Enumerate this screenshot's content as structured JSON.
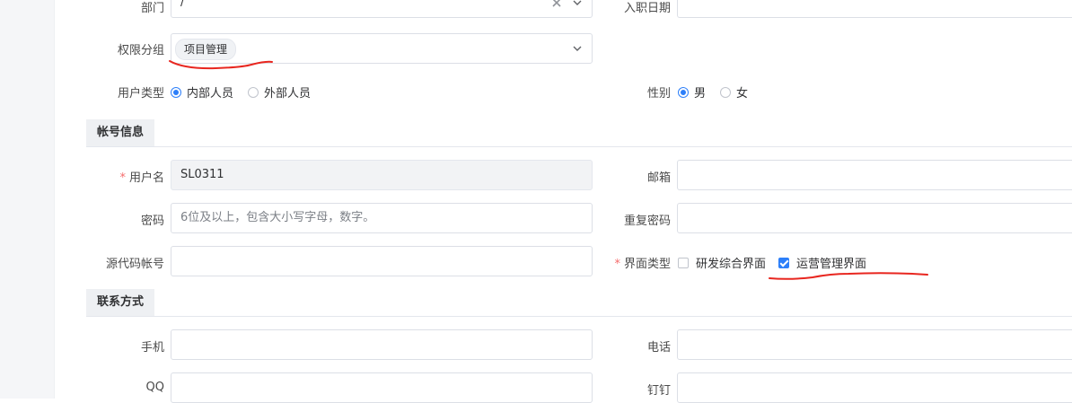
{
  "form": {
    "department": {
      "label": "部门",
      "value": "/"
    },
    "hire_date": {
      "label": "入职日期",
      "value": ""
    },
    "permission_group": {
      "label": "权限分组",
      "tags": [
        "项目管理"
      ]
    },
    "user_type": {
      "label": "用户类型",
      "options": [
        "内部人员",
        "外部人员"
      ],
      "selected": "内部人员"
    },
    "gender": {
      "label": "性别",
      "options": [
        "男",
        "女"
      ],
      "selected": "男"
    }
  },
  "sections": {
    "account": "帐号信息",
    "contact": "联系方式"
  },
  "account": {
    "username": {
      "label": "用户名",
      "value": "SL0311",
      "required": true,
      "disabled": true
    },
    "email": {
      "label": "邮箱",
      "value": ""
    },
    "password": {
      "label": "密码",
      "placeholder": "6位及以上，包含大小写字母，数字。"
    },
    "repeat_password": {
      "label": "重复密码",
      "value": ""
    },
    "source_code_account": {
      "label": "源代码帐号",
      "value": ""
    },
    "interface_type": {
      "label": "界面类型",
      "required": true,
      "options": [
        {
          "label": "研发综合界面",
          "checked": false
        },
        {
          "label": "运营管理界面",
          "checked": true
        }
      ]
    }
  },
  "contact": {
    "mobile": {
      "label": "手机",
      "value": ""
    },
    "phone": {
      "label": "电话",
      "value": ""
    },
    "qq": {
      "label": "QQ",
      "value": ""
    },
    "dingtalk": {
      "label": "钉钉",
      "value": ""
    }
  },
  "colors": {
    "accent": "#2d7ff9",
    "required": "#f56c6c",
    "annotation": "#e8261f"
  },
  "icons": {
    "select_arrow": "chevron-down-icon",
    "clear": "close-circle-icon"
  }
}
